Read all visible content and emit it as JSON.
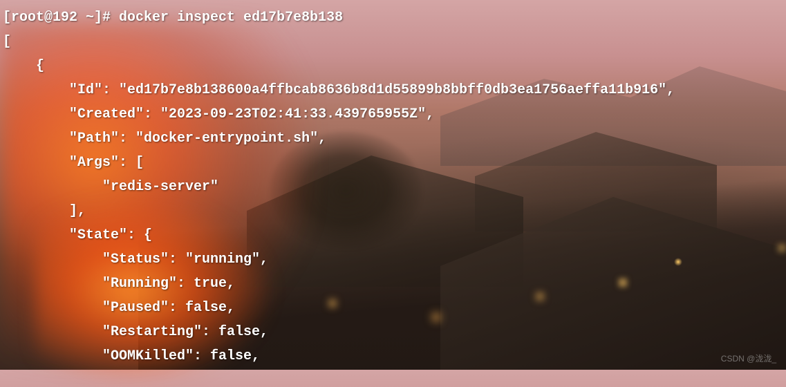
{
  "prompt": "[root@192 ~]# ",
  "command": "docker inspect ed17b7e8b138",
  "output": {
    "line1": "[",
    "line2": "    {",
    "line3": "        \"Id\": \"ed17b7e8b138600a4ffbcab8636b8d1d55899b8bbff0db3ea1756aeffa11b916\",",
    "line4": "        \"Created\": \"2023-09-23T02:41:33.439765955Z\",",
    "line5": "        \"Path\": \"docker-entrypoint.sh\",",
    "line6": "        \"Args\": [",
    "line7": "            \"redis-server\"",
    "line8": "        ],",
    "line9": "        \"State\": {",
    "line10": "            \"Status\": \"running\",",
    "line11": "            \"Running\": true,",
    "line12": "            \"Paused\": false,",
    "line13": "            \"Restarting\": false,",
    "line14": "            \"OOMKilled\": false,"
  },
  "watermark": "CSDN @泷泷_"
}
